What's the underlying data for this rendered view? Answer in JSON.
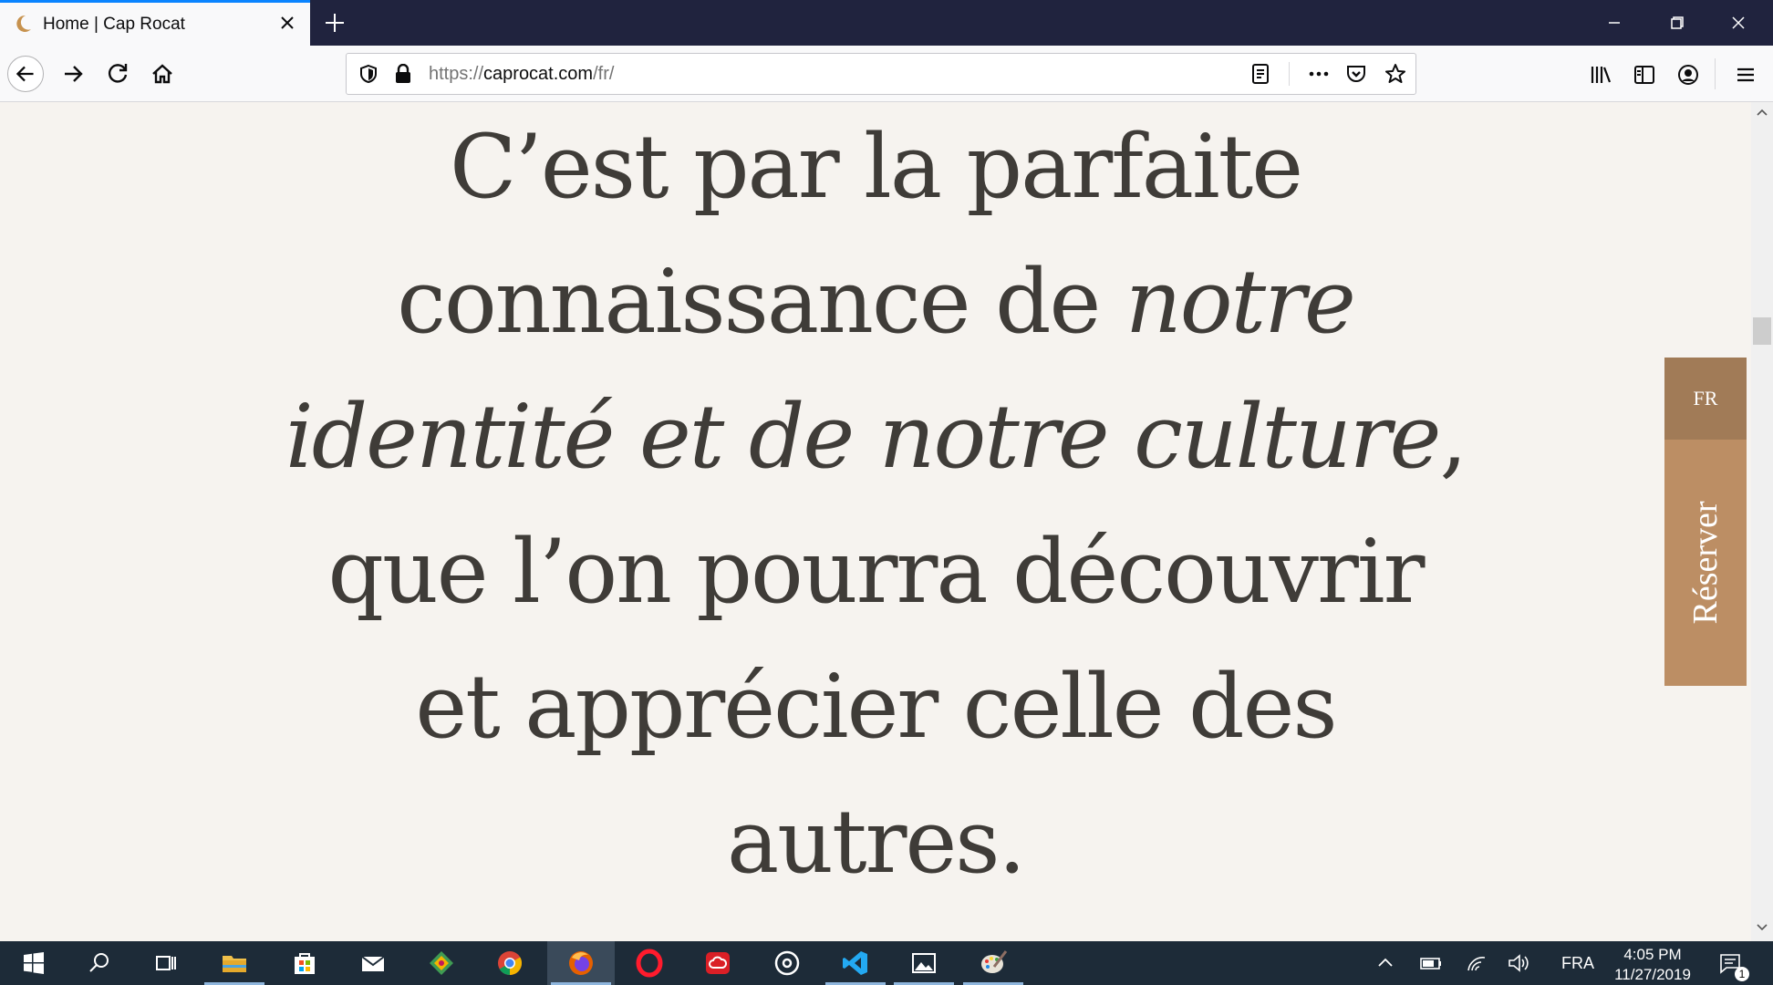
{
  "browser": {
    "tab_title": "Home | Cap Rocat",
    "url_prefix": "https://",
    "url_host": "caprocat.com",
    "url_path": "/fr/"
  },
  "page": {
    "quote_part1": "C’est par la parfaite connaissance de ",
    "quote_italic1": "notre identité et de notre culture",
    "quote_part2": ", que l’on pourra découvrir et apprécier celle des autres.",
    "lang_button": "FR",
    "reserve_button": "Réserver",
    "colors": {
      "background": "#f6f3ef",
      "text": "#3f3c38",
      "lang_tab": "#a17b57",
      "reserve_tab": "#bc8e64"
    }
  },
  "taskbar": {
    "apps": [
      "start-icon",
      "search-icon",
      "task-view-icon",
      "file-explorer-icon",
      "store-icon",
      "mail-icon",
      "git-kraken-icon",
      "chrome-icon",
      "firefox-icon",
      "opera-icon",
      "creative-cloud-icon",
      "groove-icon",
      "vscode-icon",
      "photos-icon",
      "paint-icon"
    ],
    "language": "FRA",
    "time": "4:05 PM",
    "date": "11/27/2019",
    "notification_count": "1"
  }
}
